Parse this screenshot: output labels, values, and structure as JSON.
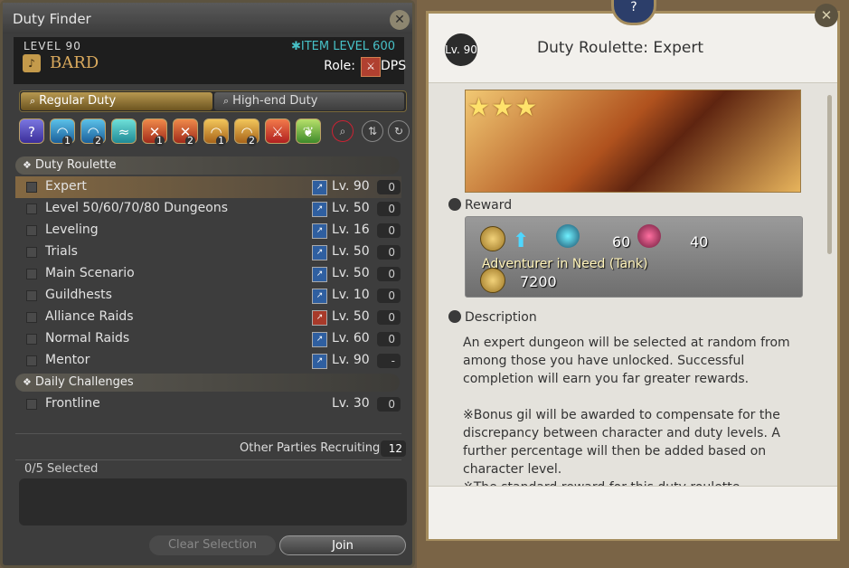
{
  "window": {
    "title": "Duty Finder",
    "close_icon": "gear-close-icon"
  },
  "character": {
    "level": "LEVEL 90",
    "job": "BARD",
    "item_level": "ITEM LEVEL 600",
    "role_label": "Role:",
    "role": "DPS"
  },
  "tabs": [
    {
      "label": "Regular Duty",
      "active": true
    },
    {
      "label": "High-end Duty",
      "active": false
    }
  ],
  "duty_icons": [
    {
      "name": "roulette-icon",
      "glyph": "?"
    },
    {
      "name": "dungeon-icon-1",
      "num": "1"
    },
    {
      "name": "dungeon-icon-2",
      "num": "2"
    },
    {
      "name": "guildhest-icon"
    },
    {
      "name": "trial-icon-1",
      "num": "1"
    },
    {
      "name": "trial-icon-2",
      "num": "2"
    },
    {
      "name": "raid-icon-1",
      "num": "1"
    },
    {
      "name": "raid-icon-2",
      "num": "2"
    },
    {
      "name": "pvp-icon"
    },
    {
      "name": "gold-saucer-icon"
    }
  ],
  "sections": [
    {
      "title": "Duty Roulette"
    },
    {
      "title": "Daily Challenges"
    }
  ],
  "roulettes": [
    {
      "name": "Expert",
      "level": "Lv. 90",
      "count": "0",
      "selected": true
    },
    {
      "name": "Level 50/60/70/80 Dungeons",
      "level": "Lv. 50",
      "count": "0"
    },
    {
      "name": "Leveling",
      "level": "Lv. 16",
      "count": "0"
    },
    {
      "name": "Trials",
      "level": "Lv. 50",
      "count": "0"
    },
    {
      "name": "Main Scenario",
      "level": "Lv. 50",
      "count": "0"
    },
    {
      "name": "Guildhests",
      "level": "Lv. 10",
      "count": "0"
    },
    {
      "name": "Alliance Raids",
      "level": "Lv. 50",
      "count": "0"
    },
    {
      "name": "Normal Raids",
      "level": "Lv. 60",
      "count": "0"
    },
    {
      "name": "Mentor",
      "level": "Lv. 90",
      "count": "-"
    }
  ],
  "daily": [
    {
      "name": "Frontline",
      "level": "Lv. 30",
      "count": "0"
    }
  ],
  "footer": {
    "recruiting_label": "Other Parties Recruiting",
    "recruiting_count": "12",
    "selected": "0/5 Selected",
    "clear_label": "Clear Selection",
    "join_label": "Join"
  },
  "detail": {
    "level": "Lv. 90",
    "title": "Duty Roulette: Expert",
    "stars": "★★★",
    "reward_label": "Reward",
    "reward_val1": "60",
    "reward_val2": "40",
    "need_label": "Adventurer in Need (Tank)",
    "need_gil": "7200",
    "description_label": "Description",
    "description": [
      "An expert dungeon will be selected at random from among those you have unlocked. Successful completion will earn you far greater rewards.",
      "※Bonus gil will be awarded to compensate for the discrepancy between character and duty levels. A further percentage will then be added based on character level.",
      "※The standard reward for this duty roulette"
    ]
  },
  "colors": {
    "accent": "#b79850",
    "ilvl": "#47c1c7"
  }
}
